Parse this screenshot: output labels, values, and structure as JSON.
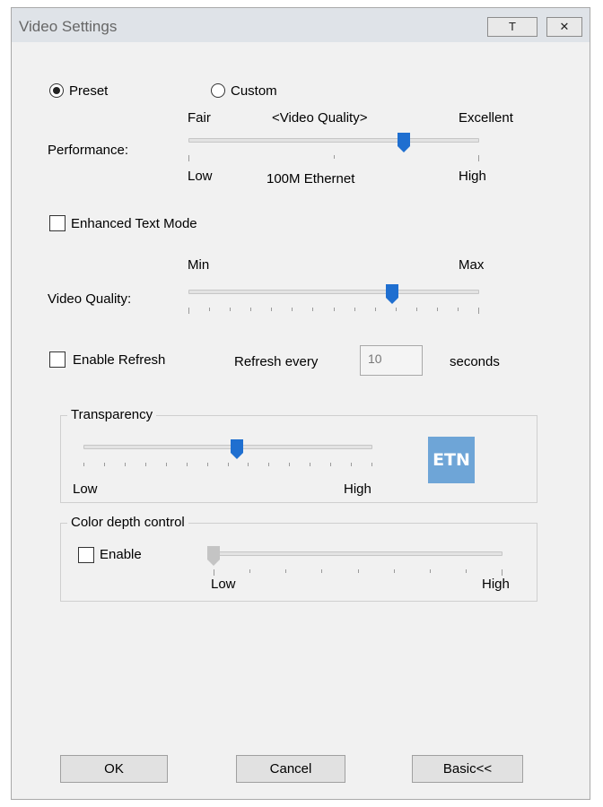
{
  "window": {
    "title": "Video Settings",
    "pin_label": "T",
    "close_label": "✕"
  },
  "mode": {
    "preset_label": "Preset",
    "custom_label": "Custom",
    "selected": "Preset"
  },
  "performance": {
    "label": "Performance:",
    "top_left": "Fair",
    "top_center": "<Video Quality>",
    "top_right": "Excellent",
    "bottom_left": "Low",
    "bottom_center": "100M Ethernet",
    "bottom_right": "High",
    "level": 0.74
  },
  "enhanced_text": {
    "label": "Enhanced Text Mode",
    "checked": false
  },
  "video_quality": {
    "label": "Video Quality:",
    "min_label": "Min",
    "max_label": "Max",
    "level": 0.7
  },
  "refresh": {
    "enable_label": "Enable Refresh",
    "checked": false,
    "every_label": "Refresh every",
    "value": "10",
    "unit_label": "seconds"
  },
  "transparency": {
    "title": "Transparency",
    "low_label": "Low",
    "high_label": "High",
    "level": 0.53,
    "logo_text": "ETN"
  },
  "color_depth": {
    "title": "Color depth control",
    "enable_label": "Enable",
    "checked": false,
    "low_label": "Low",
    "high_label": "High",
    "level": 0.0
  },
  "buttons": {
    "ok": "OK",
    "cancel": "Cancel",
    "basic": "Basic<<"
  },
  "colors": {
    "accent": "#1f6fd0",
    "disabled_thumb": "#c4c4c4",
    "logo": "#6ea5d7"
  },
  "icons": {
    "pin": "pin-icon",
    "close": "close-icon"
  }
}
